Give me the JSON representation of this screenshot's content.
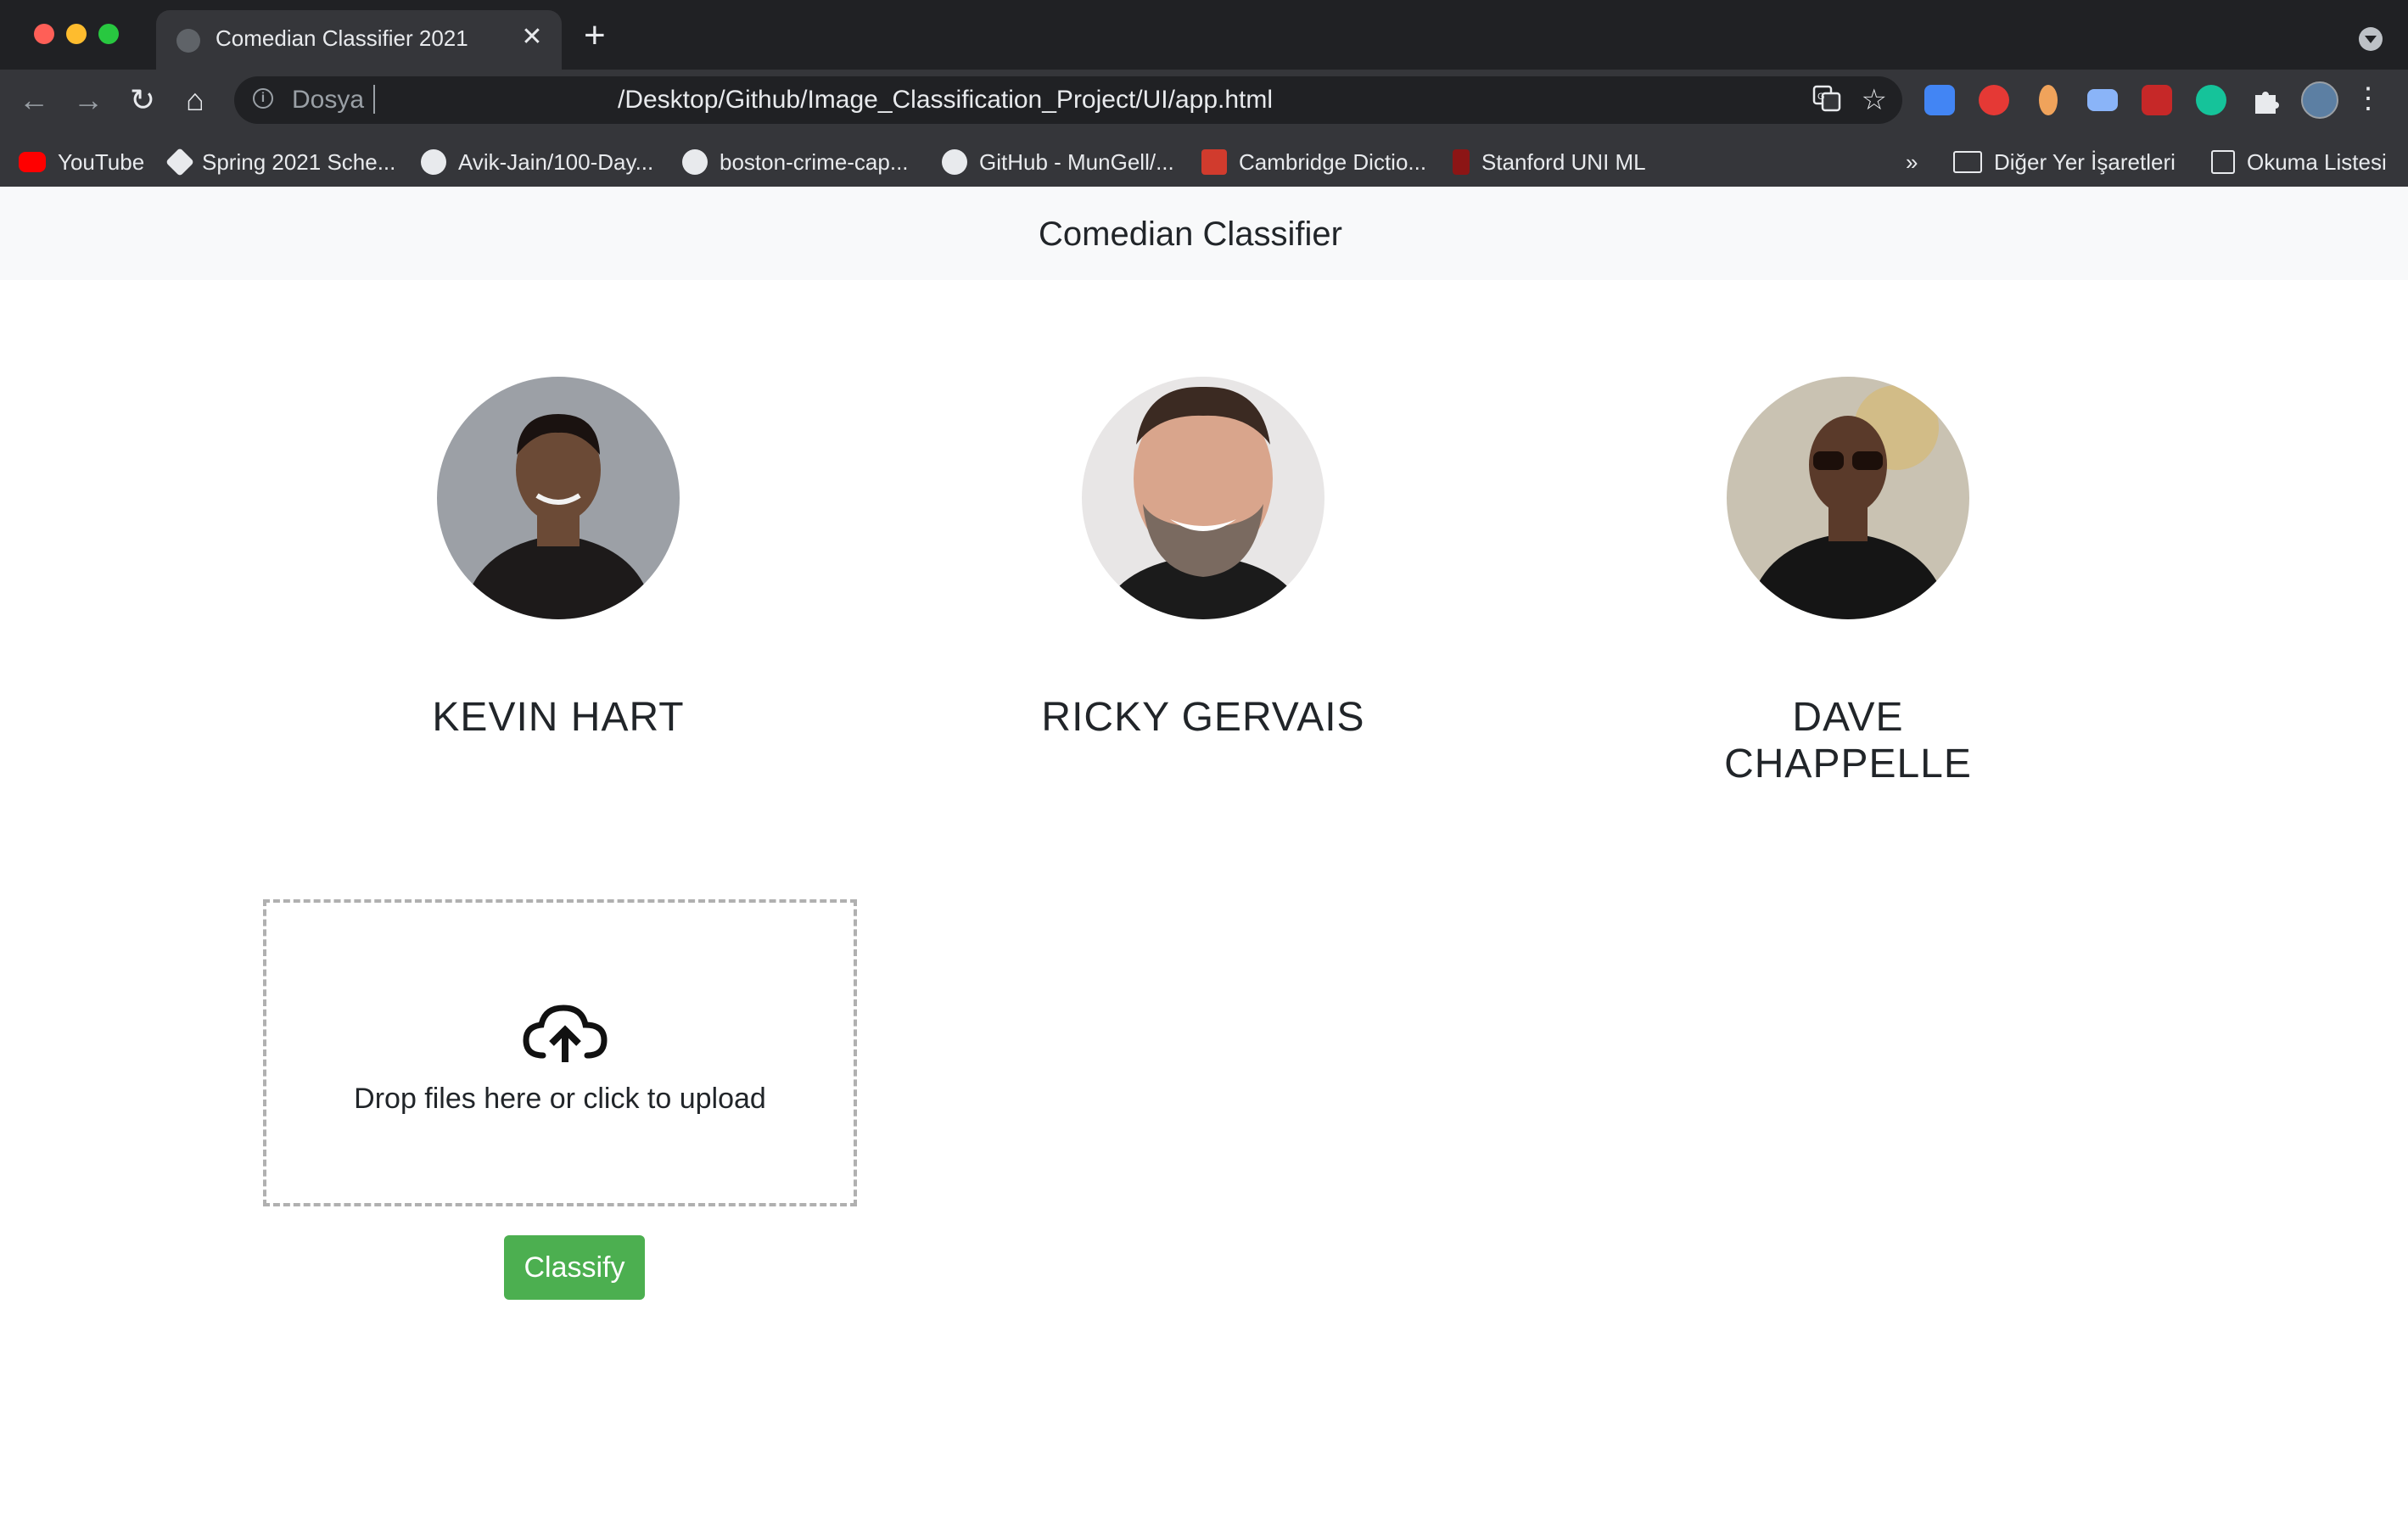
{
  "tab": {
    "title": "Comedian Classifier 2021",
    "close": "✕"
  },
  "nav": {
    "new_tab": "+",
    "back": "←",
    "forward": "→",
    "reload": "↻",
    "home": "⌂"
  },
  "address": {
    "scheme": "Dosya",
    "url": "/Desktop/Github/Image_Classification_Project/UI/app.html"
  },
  "bookmarks": [
    {
      "label": "YouTube",
      "icon": "youtube-icon",
      "color": "#ff0000"
    },
    {
      "label": "Spring 2021 Sche...",
      "icon": "canvas-icon",
      "color": "#ffffff"
    },
    {
      "label": "Avik-Jain/100-Day...",
      "icon": "github-icon",
      "color": "#ffffff"
    },
    {
      "label": "boston-crime-cap...",
      "icon": "github-icon",
      "color": "#ffffff"
    },
    {
      "label": "GitHub - MunGell/...",
      "icon": "github-icon",
      "color": "#ffffff"
    },
    {
      "label": "Cambridge Dictio...",
      "icon": "cambridge-icon",
      "color": "#d13b2d"
    },
    {
      "label": "Stanford UNI ML",
      "icon": "stanford-icon",
      "color": "#8c1515"
    }
  ],
  "bookmarks_overflow": "»",
  "other_bookmarks": "Diğer Yer İşaretleri",
  "reading_list": "Okuma Listesi",
  "app": {
    "brand": "Comedian Classifier"
  },
  "comedians": [
    {
      "name": "KEVIN HART",
      "skin": "#6b4a36",
      "bg": "#9ca0a6",
      "shirt": "#1d1a1a"
    },
    {
      "name": "RICKY GERVAIS",
      "skin": "#d9a58c",
      "bg": "#e8e6e6",
      "shirt": "#1b1b1b"
    },
    {
      "name": "DAVE CHAPPELLE",
      "skin": "#5a3a2a",
      "bg": "#c9c2b2",
      "shirt": "#151515"
    }
  ],
  "upload": {
    "text": "Drop files here or click to upload"
  },
  "classify_button": "Classify"
}
